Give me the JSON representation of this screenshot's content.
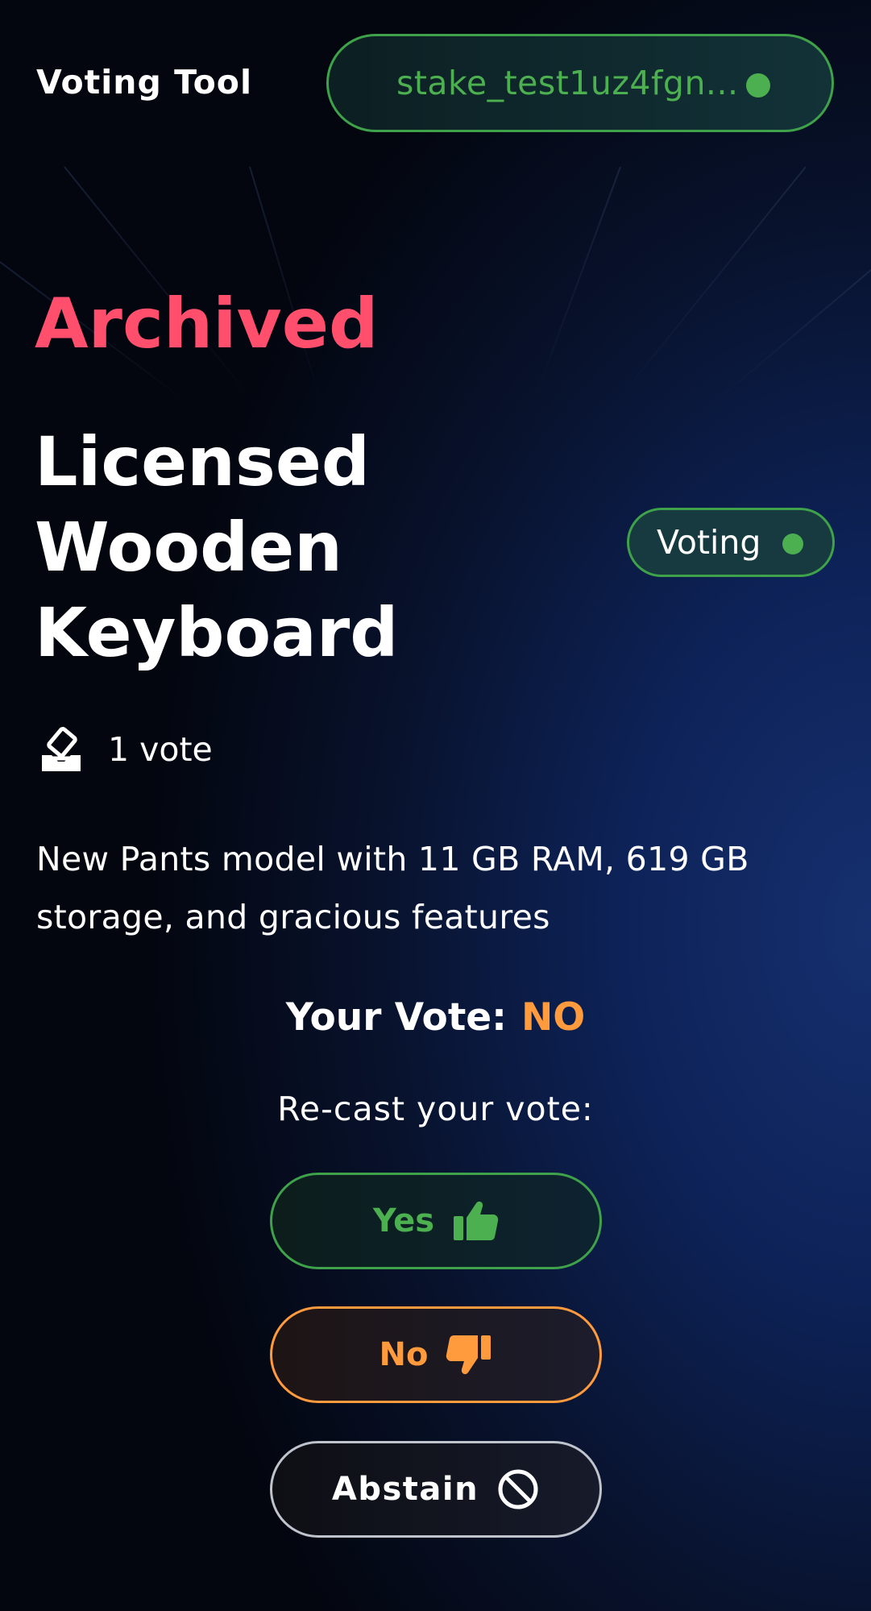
{
  "header": {
    "app_title": "Voting Tool",
    "wallet_address": "stake_test1uz4fgn...",
    "wallet_status_color": "#4caf50"
  },
  "proposal": {
    "status_heading": "Archived",
    "title_lines": [
      "Licensed",
      "Wooden",
      "Keyboard"
    ],
    "state_label": "Voting",
    "vote_count": "1 vote",
    "description": "New Pants model with 11 GB RAM, 619 GB storage, and gracious features"
  },
  "your_vote": {
    "label": "Your Vote:",
    "value": "NO"
  },
  "recast_label": "Re-cast your vote:",
  "buttons": {
    "yes": {
      "label": "Yes",
      "icon": "thumbs-up-icon"
    },
    "no": {
      "label": "No",
      "icon": "thumbs-down-icon"
    },
    "abstain": {
      "label": "Abstain",
      "icon": "ban-icon"
    }
  },
  "colors": {
    "archived": "#ff4f6d",
    "yes": "#4caf50",
    "no": "#ff9a3d",
    "abstain_border": "#bfc3cc"
  }
}
